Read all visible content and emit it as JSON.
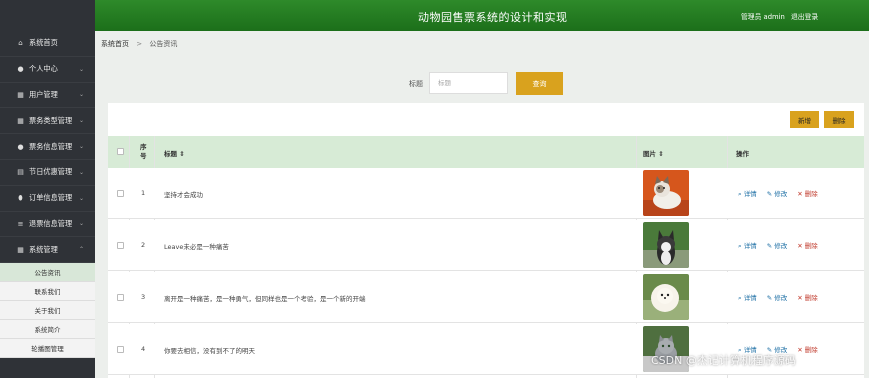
{
  "header": {
    "title": "动物园售票系统的设计和实现",
    "user": "管理员 admin",
    "logout": "退出登录"
  },
  "sidebar": {
    "items": [
      {
        "label": "系统首页",
        "icon": "home-icon",
        "glyph": "⌂",
        "chev": ""
      },
      {
        "label": "个人中心",
        "icon": "user-icon",
        "glyph": "●",
        "chev": "⌄"
      },
      {
        "label": "用户管理",
        "icon": "grid-icon",
        "glyph": "▦",
        "chev": "⌄"
      },
      {
        "label": "票务类型管理",
        "icon": "grid-icon",
        "glyph": "▦",
        "chev": "⌄"
      },
      {
        "label": "票务信息管理",
        "icon": "user-icon",
        "glyph": "●",
        "chev": "⌄"
      },
      {
        "label": "节日优惠管理",
        "icon": "calendar-icon",
        "glyph": "▤",
        "chev": "⌄"
      },
      {
        "label": "订单信息管理",
        "icon": "pin-icon",
        "glyph": "⬮",
        "chev": "⌄"
      },
      {
        "label": "退票信息管理",
        "icon": "sliders-icon",
        "glyph": "≡",
        "chev": "⌄"
      },
      {
        "label": "系统管理",
        "icon": "grid-icon",
        "glyph": "▦",
        "chev": "⌃"
      }
    ],
    "subitems": [
      "公告资讯",
      "联系我们",
      "关于我们",
      "系统简介",
      "轮播图管理"
    ]
  },
  "breadcrumb": {
    "home": "系统首页",
    "sep": ">",
    "current": "公告资讯"
  },
  "search": {
    "label": "标题",
    "placeholder": "标题",
    "button": "查询"
  },
  "toolbar": {
    "add": "新增",
    "delete": "删除"
  },
  "table": {
    "columns": {
      "index": "序号",
      "title": "标题 ⇕",
      "image": "图片 ⇕",
      "ops": "操作"
    },
    "rows": [
      {
        "index": "1",
        "title": "坚持才会成功",
        "image": "cat-photo"
      },
      {
        "index": "2",
        "title": "Leave未必是一种痛苦",
        "image": "husky-photo"
      },
      {
        "index": "3",
        "title": "离开是一种痛苦，是一种勇气，但同样也是一个考验，是一个新的开端",
        "image": "pomeranian-photo"
      },
      {
        "index": "4",
        "title": "你要去相信，没有到不了的明天",
        "image": "cat-photo-2"
      }
    ],
    "ops": {
      "view": "详情",
      "edit": "修改",
      "delete": "删除"
    }
  },
  "watermark": "CSDN @杰记计算机程序源码",
  "colors": {
    "header": "#1f7a1d",
    "accent": "#d9a21e",
    "sidebar": "#2f3237",
    "thead": "#d7ebd6"
  }
}
